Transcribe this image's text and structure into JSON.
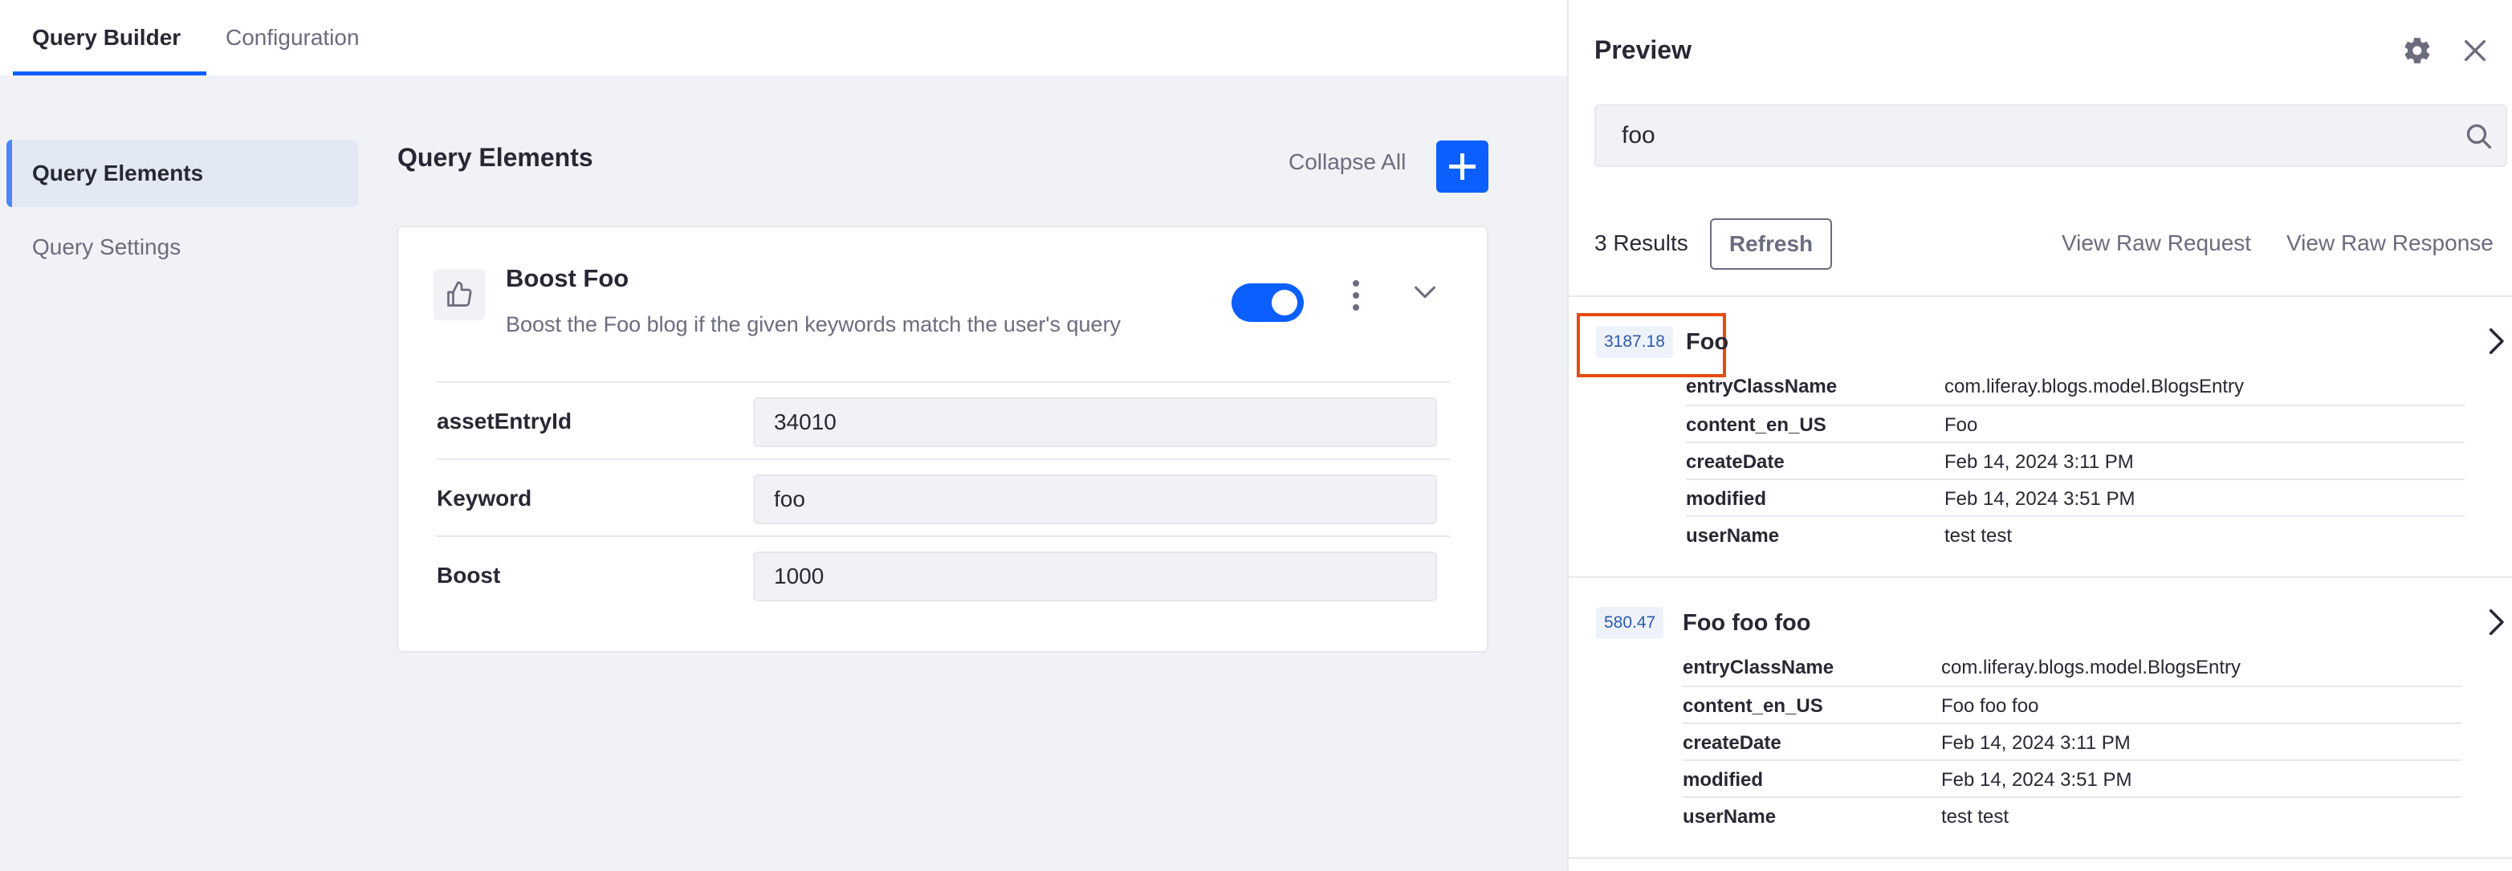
{
  "tabs": [
    {
      "label": "Query Builder",
      "active": true
    },
    {
      "label": "Configuration",
      "active": false
    }
  ],
  "sidenav": [
    {
      "label": "Query Elements",
      "active": true
    },
    {
      "label": "Query Settings",
      "active": false
    }
  ],
  "main": {
    "title": "Query Elements",
    "collapse_all": "Collapse All",
    "add_icon": "plus-icon",
    "element": {
      "icon": "thumbs-up-icon",
      "title": "Boost Foo",
      "description": "Boost the Foo blog if the given keywords match the user's query",
      "enabled": true,
      "fields": [
        {
          "label": "assetEntryId",
          "value": "34010"
        },
        {
          "label": "Keyword",
          "value": "foo"
        },
        {
          "label": "Boost",
          "value": "1000"
        }
      ]
    }
  },
  "preview": {
    "title": "Preview",
    "search_value": "foo",
    "results_count": "3 Results",
    "refresh_label": "Refresh",
    "view_raw_request": "View Raw Request",
    "view_raw_response": "View Raw Response",
    "results": [
      {
        "score": "3187.18",
        "title": "Foo",
        "highlighted": true,
        "props": [
          {
            "key": "entryClassName",
            "value": "com.liferay.blogs.model.BlogsEntry"
          },
          {
            "key": "content_en_US",
            "value": "Foo"
          },
          {
            "key": "createDate",
            "value": "Feb 14, 2024 3:11 PM"
          },
          {
            "key": "modified",
            "value": "Feb 14, 2024 3:51 PM"
          },
          {
            "key": "userName",
            "value": "test test"
          }
        ]
      },
      {
        "score": "580.47",
        "title": "Foo foo foo",
        "highlighted": false,
        "props": [
          {
            "key": "entryClassName",
            "value": "com.liferay.blogs.model.BlogsEntry"
          },
          {
            "key": "content_en_US",
            "value": "Foo foo foo"
          },
          {
            "key": "createDate",
            "value": "Feb 14, 2024 3:11 PM"
          },
          {
            "key": "modified",
            "value": "Feb 14, 2024 3:51 PM"
          },
          {
            "key": "userName",
            "value": "test test"
          }
        ]
      }
    ]
  },
  "colors": {
    "primary": "#0b5fff",
    "highlight_border": "#e8490f",
    "score_badge_bg": "#eef2fa",
    "score_badge_text": "#2e5aac"
  }
}
